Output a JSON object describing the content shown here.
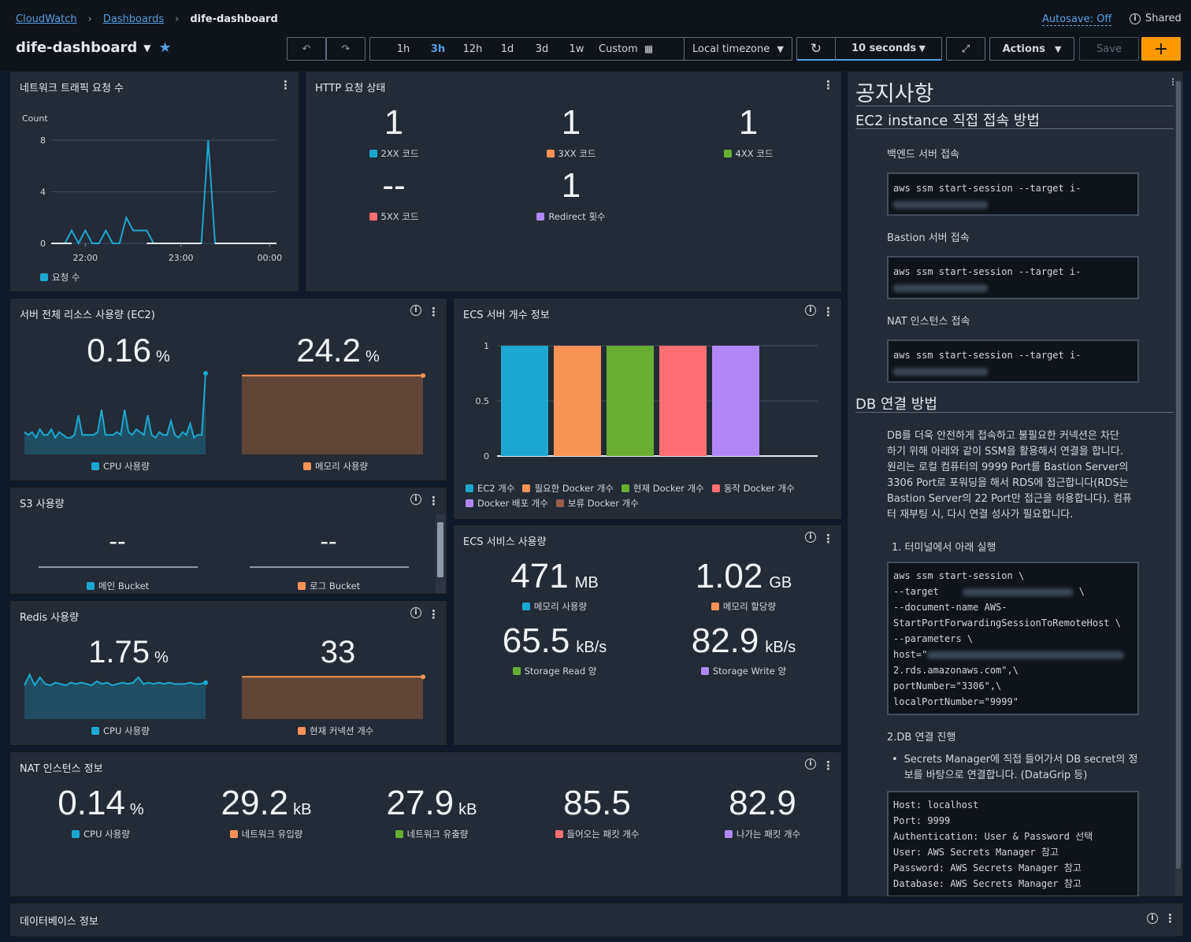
{
  "breadcrumb": {
    "root": "CloudWatch",
    "dashboards": "Dashboards",
    "current": "dife-dashboard"
  },
  "autosave": "Autosave: Off",
  "shared": "Shared",
  "dashboard_title": "dife-dashboard",
  "time_ranges": [
    "1h",
    "3h",
    "12h",
    "1d",
    "3d",
    "1w"
  ],
  "selected_range": "3h",
  "custom": "Custom",
  "timezone": "Local timezone",
  "refresh_interval": "10 seconds",
  "actions": "Actions",
  "save": "Save",
  "add": "+",
  "colors": {
    "blue": "#1ca7d0",
    "orange": "#f89256",
    "green": "#69ae34",
    "red": "#fe6e73",
    "purple": "#b088f5",
    "brown": "#9a5f4c"
  },
  "traffic": {
    "title": "네트워크 트래픽 요청 수",
    "ylabel": "Count",
    "legend": "요청 수",
    "chart_data": {
      "type": "line",
      "x": [
        "21:40",
        "21:45",
        "21:50",
        "21:53",
        "21:56",
        "22:00",
        "22:05",
        "22:08",
        "22:12",
        "22:15",
        "22:18",
        "22:22",
        "22:25",
        "22:30",
        "22:35",
        "22:40",
        "22:45",
        "22:50",
        "22:55",
        "23:00",
        "23:05",
        "23:10",
        "23:13",
        "23:16",
        "23:20",
        "23:25",
        "23:30",
        "23:35",
        "23:40",
        "23:45",
        "23:50",
        "23:55",
        "00:00",
        "00:05"
      ],
      "series": [
        {
          "name": "요청 수",
          "values": [
            0,
            0,
            0,
            1,
            0,
            1,
            0,
            0,
            1,
            0,
            0,
            2,
            1,
            1,
            1,
            0,
            0,
            0,
            0,
            0,
            0,
            0,
            0,
            8,
            0,
            0,
            0,
            0,
            0,
            0,
            0,
            0,
            0,
            0
          ]
        }
      ],
      "ylim": [
        0,
        8
      ],
      "yticks": [
        "0",
        "4",
        "8"
      ],
      "xticks": [
        "22:00",
        "23:00",
        "00:00"
      ]
    }
  },
  "http": {
    "title": "HTTP 요청 상태",
    "items": [
      {
        "value": "1",
        "label": "2XX 코드"
      },
      {
        "value": "1",
        "label": "3XX 코드"
      },
      {
        "value": "1",
        "label": "4XX 코드"
      },
      {
        "value": "--",
        "label": "5XX 코드"
      },
      {
        "value": "1",
        "label": "Redirect 횟수"
      }
    ]
  },
  "ec2": {
    "title": "서버 전체 리소스 사용량 (EC2)",
    "cpu_value": "0.16",
    "cpu_unit": "%",
    "cpu_label": "CPU 사용량",
    "mem_value": "24.2",
    "mem_unit": "%",
    "mem_label": "메모리 사용량",
    "chart_data": {
      "type": "area",
      "series": [
        {
          "name": "CPU 사용량",
          "values": [
            0.13,
            0.12,
            0.13,
            0.11,
            0.14,
            0.12,
            0.12,
            0.14,
            0.11,
            0.13,
            0.12,
            0.11,
            0.11,
            0.12,
            0.19,
            0.12,
            0.12,
            0.12,
            0.12,
            0.13,
            0.21,
            0.12,
            0.12,
            0.12,
            0.13,
            0.12,
            0.21,
            0.13,
            0.12,
            0.14,
            0.13,
            0.12,
            0.19,
            0.12,
            0.11,
            0.13,
            0.12,
            0.12,
            0.17,
            0.12,
            0.11,
            0.13,
            0.12,
            0.16,
            0.11,
            0.12,
            0.12,
            0.34
          ]
        },
        {
          "name": "메모리 사용량",
          "values": [
            24.2,
            24.2
          ]
        }
      ]
    }
  },
  "ecs_count": {
    "title": "ECS 서버 개수 정보",
    "chart_data": {
      "type": "bar",
      "categories": [
        "EC2 개수",
        "필요한 Docker 개수",
        "현재 Docker 개수",
        "동작 Docker 개수",
        "Docker 배포 개수",
        "보류 Docker 개수"
      ],
      "values": [
        1,
        1,
        1,
        1,
        1,
        0
      ],
      "ylim": [
        0,
        1
      ],
      "yticks": [
        "0",
        "0.5",
        "1"
      ]
    },
    "legend": [
      "EC2 개수",
      "필요한 Docker 개수",
      "현재 Docker 개수",
      "동작 Docker 개수",
      "Docker 배포 개수",
      "보류 Docker 개수"
    ]
  },
  "s3": {
    "title": "S3 사용량",
    "main_value": "--",
    "main_label": "메인 Bucket",
    "log_value": "--",
    "log_label": "로그 Bucket"
  },
  "ecs_svc": {
    "title": "ECS 서비스 사용량",
    "items": [
      {
        "value": "471",
        "unit": "MB",
        "label": "메모리 사용량"
      },
      {
        "value": "1.02",
        "unit": "GB",
        "label": "메모리 할당량"
      },
      {
        "value": "65.5",
        "unit": "kB/s",
        "label": "Storage Read 양"
      },
      {
        "value": "82.9",
        "unit": "kB/s",
        "label": "Storage Write 양"
      }
    ]
  },
  "redis": {
    "title": "Redis 사용량",
    "cpu_value": "1.75",
    "cpu_unit": "%",
    "cpu_label": "CPU 사용량",
    "conn_value": "33",
    "conn_label": "현재 커넥션 개수",
    "chart_data": {
      "type": "area",
      "series": [
        {
          "name": "CPU 사용량",
          "values": [
            1.7,
            1.78,
            1.7,
            1.76,
            1.71,
            1.7,
            1.72,
            1.71,
            1.7,
            1.72,
            1.71,
            1.72,
            1.71,
            1.7,
            1.73,
            1.71,
            1.72,
            1.7,
            1.71,
            1.72,
            1.71,
            1.72,
            1.76,
            1.71,
            1.72,
            1.71,
            1.72,
            1.71,
            1.72,
            1.71,
            1.71,
            1.71,
            1.72,
            1.71,
            1.71,
            1.72
          ]
        },
        {
          "name": "현재 커넥션 개수",
          "values": [
            33,
            33
          ]
        }
      ]
    }
  },
  "nat": {
    "title": "NAT 인스턴스 정보",
    "items": [
      {
        "value": "0.14",
        "unit": "%",
        "label": "CPU 사용량"
      },
      {
        "value": "29.2",
        "unit": "kB",
        "label": "네트워크 유입량"
      },
      {
        "value": "27.9",
        "unit": "kB",
        "label": "네트워크 유출량"
      },
      {
        "value": "85.5",
        "unit": "",
        "label": "들어오는 패킷 개수"
      },
      {
        "value": "82.9",
        "unit": "",
        "label": "나가는 패킷 개수"
      }
    ]
  },
  "db_panel": {
    "title": "데이터베이스 정보"
  },
  "notice": {
    "title": "공지사항",
    "ec2_heading": "EC2 instance 직접 접속 방법",
    "backend": "백엔드 서버 접속",
    "bastion": "Bastion 서버 접속",
    "nat": "NAT 인스턴스 접속",
    "ssm_cmd": "aws ssm start-session --target i-",
    "db_heading": "DB 연결 방법",
    "db_para": [
      "DB를 더욱 안전하게 접속하고 불필요한 커넥션은 차단",
      "하기 위해 아래와 같이 SSM을 활용해서 연결을 합니다.",
      "원리는 로컬 컴퓨터의 9999 Port를 Bastion Server의",
      "3306 Port로 포워딩을 해서 RDS에 접근합니다(RDS는",
      "Bastion Server의 22 Port만 접근을 허용합니다). 컴퓨",
      "터 재부팅 시, 다시 연결 성사가 필요합니다."
    ],
    "step1": "1. 터미널에서 아래 실행",
    "cmd_lines": [
      "aws ssm start-session \\",
      "--target",
      "--document-name AWS-",
      "StartPortForwardingSessionToRemoteHost \\",
      "--parameters \\",
      "host=\"",
      "2.rds.amazonaws.com\",\\",
      "portNumber=\"3306\",\\",
      "localPortNumber=\"9999\""
    ],
    "step2": "2.DB 연결 진행",
    "bullet": [
      "Secrets Manager에 직접 들어가서 DB secret의 정",
      "보를 바탕으로 연결합니다. (DataGrip 등)"
    ],
    "conn_lines": [
      "Host: localhost",
      "Port: 9999",
      "Authentication: User & Password 선택",
      "User: AWS Secrets Manager 참고",
      "Password: AWS Secrets Manager 참고",
      "Database: AWS Secrets Manager 참고"
    ]
  }
}
